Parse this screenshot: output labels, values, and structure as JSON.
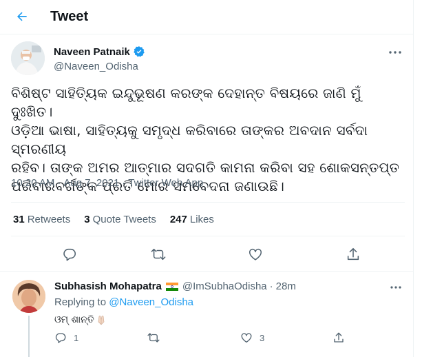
{
  "header": {
    "title": "Tweet"
  },
  "tweet": {
    "author_name": "Naveen Patnaik",
    "author_handle": "@Naveen_Odisha",
    "text_lines": [
      "ବିଶିଷ୍ଟ ସାହିତ୍ୟିକ ଇନ୍ଦୁଭୂଷଣ କରଙ୍କ ଦେହାନ୍ତ ବିଷୟରେ ଜାଣି ମୁଁ ଦୁଃଖିତ।",
      "ଓଡ଼ିଆ ଭାଷା, ସାହିତ୍ୟକୁ ସମୃଦ୍ଧ କରିବାରେ ତାଙ୍କର ଅବଦାନ ସର୍ବଦା ସ୍ମରଣୀୟ",
      "ରହିବ। ତାଙ୍କ ଅମର ଆତ୍ମାର ସଦଗତି କାମନା କରିବା ସହ ଶୋକସନ୍ତପ୍ତ",
      "ପରିବାରବର୍ଗଙ୍କ ପ୍ରତି ମୋର ସମବେଦନା ଜଣାଉଛି।"
    ],
    "time": "10:20 AM",
    "separator": "·",
    "date": "Aug 7, 2021",
    "source": "Twitter Web App",
    "stats": {
      "retweets_count": "31",
      "retweets_label": "Retweets",
      "quotes_count": "3",
      "quotes_label": "Quote Tweets",
      "likes_count": "247",
      "likes_label": "Likes"
    }
  },
  "reply": {
    "name": "Subhasish Mohapatra",
    "flag": "india-flag-icon",
    "handle": "@ImSubhaOdisha",
    "separator": "·",
    "time": "28m",
    "replying_prefix": "Replying to",
    "replying_to": "@Naveen_Odisha",
    "text": "ଓମ୍ ଶାନ୍ତି",
    "emoji": "folded-hands-icon",
    "reply_count": "1",
    "retweet_count": "",
    "like_count": "3"
  },
  "colors": {
    "accent": "#1d9bf0",
    "text": "#0f1419",
    "secondary": "#536471",
    "border": "#eff3f4"
  }
}
